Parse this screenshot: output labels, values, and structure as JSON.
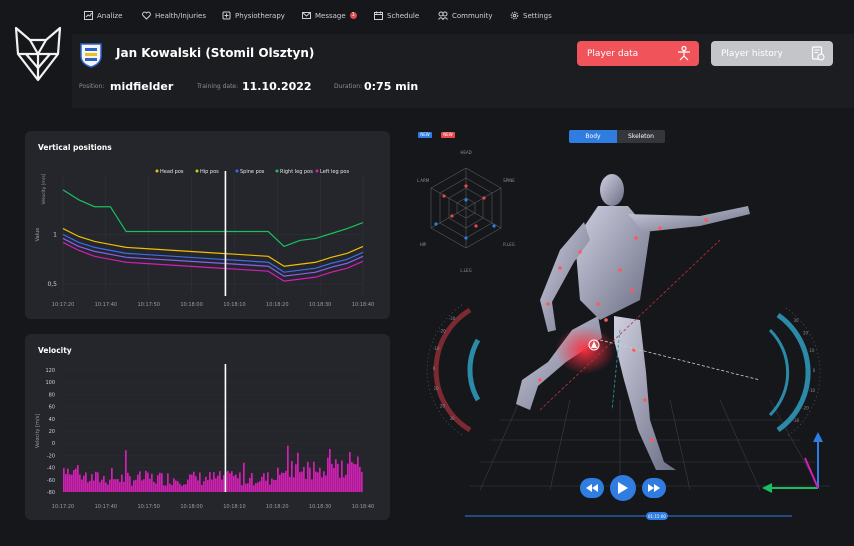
{
  "nav": {
    "items": [
      {
        "label": "Analize",
        "icon": "analytics-icon"
      },
      {
        "label": "Health/Injuries",
        "icon": "heart-icon"
      },
      {
        "label": "Physiotherapy",
        "icon": "physio-icon"
      },
      {
        "label": "Message",
        "icon": "message-icon",
        "badge": "1"
      },
      {
        "label": "Schedule",
        "icon": "calendar-icon"
      },
      {
        "label": "Community",
        "icon": "community-icon"
      },
      {
        "label": "Settings",
        "icon": "gear-icon"
      }
    ]
  },
  "player": {
    "name": "Jan Kowalski (Stomil Olsztyn)",
    "position_label": "Position:",
    "position_value": "midfielder",
    "date_label": "Training date:",
    "date_value": "11.10.2022",
    "duration_label": "Duration:",
    "duration_value": "0:75 min"
  },
  "buttons": {
    "player_data": "Player data",
    "player_history": "Player history"
  },
  "colors": {
    "accent_red": "#f0545a",
    "accent_blue": "#2f7de0",
    "card_bg": "#24262b",
    "magenta": "#d21fb4"
  },
  "view_toggle": {
    "body": "Body",
    "skeleton": "Skeleton",
    "tag_blue": "NEW",
    "tag_red": "NEW"
  },
  "playback": {
    "time_label": "01:15:00"
  },
  "chart_data": [
    {
      "type": "line",
      "title": "Vertical positions",
      "ylabel": "Value",
      "ylabel2": "Velocity [m/s]",
      "ytick_labels": [
        "1",
        "0,5"
      ],
      "x_tick_labels": [
        "10:17:20",
        "10:17:40",
        "10:17:50",
        "10:18:00",
        "10:18:10",
        "10:18:20",
        "10:18:30",
        "10:18:40"
      ],
      "legend": [
        "Head pos",
        "Hip pos",
        "Spine pos",
        "Right leg pos",
        "Left leg pos"
      ],
      "series_colors": [
        "#f0c000",
        "#c8d400",
        "#3c6cf0",
        "#18c060",
        "#d21fb4"
      ],
      "cursor_x": "10:18:10",
      "series": [
        {
          "name": "Right leg pos",
          "color": "#18c060",
          "values": [
            1.45,
            1.35,
            1.28,
            1.28,
            1.03,
            1.03,
            1.03,
            1.03,
            1.03,
            1.03,
            1.03,
            1.03,
            1.03,
            1.03,
            0.88,
            0.94,
            0.96,
            1.01,
            1.06,
            1.12
          ]
        },
        {
          "name": "Head pos",
          "color": "#f0c000",
          "values": [
            1.06,
            0.98,
            0.93,
            0.9,
            0.87,
            0.86,
            0.85,
            0.84,
            0.83,
            0.82,
            0.81,
            0.8,
            0.79,
            0.78,
            0.68,
            0.7,
            0.72,
            0.77,
            0.81,
            0.88
          ]
        },
        {
          "name": "Spine pos",
          "color": "#3c6cf0",
          "values": [
            1.0,
            0.92,
            0.87,
            0.84,
            0.81,
            0.8,
            0.79,
            0.78,
            0.77,
            0.76,
            0.75,
            0.74,
            0.73,
            0.72,
            0.62,
            0.64,
            0.66,
            0.71,
            0.75,
            0.82
          ]
        },
        {
          "name": "Hip pos",
          "color": "#8860f0",
          "values": [
            0.96,
            0.88,
            0.83,
            0.8,
            0.77,
            0.76,
            0.75,
            0.74,
            0.73,
            0.72,
            0.71,
            0.7,
            0.69,
            0.68,
            0.58,
            0.6,
            0.62,
            0.67,
            0.71,
            0.78
          ]
        },
        {
          "name": "Left leg pos",
          "color": "#d21fb4",
          "values": [
            0.92,
            0.84,
            0.78,
            0.75,
            0.72,
            0.71,
            0.7,
            0.69,
            0.68,
            0.67,
            0.66,
            0.65,
            0.64,
            0.63,
            0.53,
            0.55,
            0.57,
            0.62,
            0.66,
            0.73
          ]
        }
      ],
      "ylim": [
        0.4,
        1.6
      ]
    },
    {
      "type": "bar",
      "title": "Velocity",
      "ylabel": "Velocity [m/s]",
      "y_tick_labels": [
        "120",
        "100",
        "80",
        "60",
        "40",
        "20",
        "0",
        "-20",
        "-40",
        "-60",
        "-80"
      ],
      "x_tick_labels": [
        "10:17:20",
        "10:17:40",
        "10:17:50",
        "10:18:00",
        "10:18:10",
        "10:18:20",
        "10:18:30",
        "10:18:40"
      ],
      "ylim": [
        -80,
        120
      ],
      "cursor_x": "10:18:10",
      "color": "#d21fb4"
    }
  ],
  "radar": {
    "labels": [
      "HEAD",
      "SPINE",
      "R.LEG",
      "L.LEG",
      "HIP",
      "L.ARM"
    ]
  },
  "gauges": {
    "left_labels": [
      "-30",
      "-20",
      "-10",
      "0",
      "10",
      "20",
      "30"
    ],
    "right_labels": [
      "30",
      "20",
      "10",
      "0",
      "-10",
      "-20",
      "-30"
    ]
  }
}
